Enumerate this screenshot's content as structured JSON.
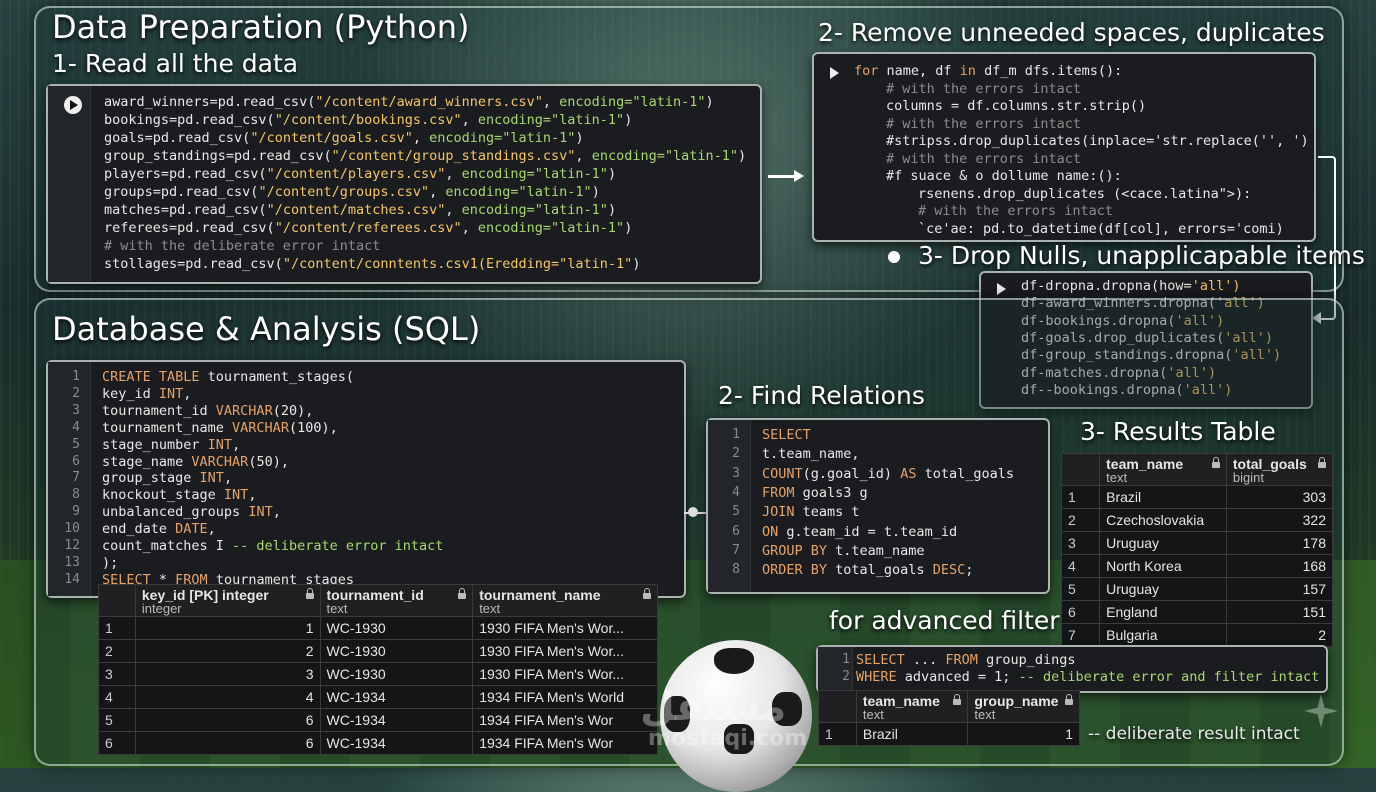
{
  "python": {
    "title": "Data Preparation (Python)",
    "step1": "1- Read all the data",
    "read_lines": [
      {
        "a": "award_winners=pd.read_csv(",
        "s": "\"/content/award_winners.csv\"",
        "b": ", ",
        "e": "encoding=\"latin-1\"",
        "c": ")"
      },
      {
        "a": "bookings=pd.read_csv(",
        "s": "\"/content/bookings.csv\"",
        "b": ", ",
        "e": "encoding=\"latin-1\"",
        "c": ")"
      },
      {
        "a": "goals=pd.read_csv(",
        "s": "\"/content/goals.csv\"",
        "b": ", ",
        "e": "encoding=\"latin-1\"",
        "c": ")"
      },
      {
        "a": "group_standings=pd.read_csv(",
        "s": "\"/content/group_standings.csv\"",
        "b": ", ",
        "e": "encoding=\"latin-1\"",
        "c": ")"
      },
      {
        "a": "players=pd.read_csv(",
        "s": "\"/content/players.csv\"",
        "b": ", ",
        "e": "encoding=\"latin-1\"",
        "c": ")"
      },
      {
        "a": "groups=pd.read_csv(",
        "s": "\"/content/groups.csv\"",
        "b": ", ",
        "e": "encoding=\"latin-1\"",
        "c": ")"
      },
      {
        "a": "matches=pd.read_csv(",
        "s": "\"/content/matches.csv\"",
        "b": ", ",
        "e": "encoding=\"latin-1\"",
        "c": ")"
      },
      {
        "a": "referees=pd.read_csv(",
        "s": "\"/content/referees.csv\"",
        "b": ", ",
        "e": "encoding=\"latin-1\"",
        "c": ")"
      },
      {
        "cmt": "# with the deliberate error intact"
      },
      {
        "a": "stollages=pd.read_csv(",
        "s": "\"/content/conntents.csv1(Eredding=\"latin-1\"",
        "b": "",
        "e": "",
        "c": ")"
      }
    ],
    "step2": "2- Remove unneeded spaces, duplicates",
    "clean_lines": [
      {
        "t": "for name, df in df_m dfs.items():",
        "ind": 0
      },
      {
        "t": "# with the errors intact",
        "ind": 1,
        "cmt": true
      },
      {
        "t": "columns = df.columns.str.strip()",
        "ind": 1
      },
      {
        "t": "# with the errors intact",
        "ind": 1,
        "cmt": true
      },
      {
        "t": "#stripss.drop_duplicates(inplace='str.replace('', ')",
        "ind": 1
      },
      {
        "t": "# with the errors intact",
        "ind": 1,
        "cmt": true
      },
      {
        "t": "#f suace & o dollume name:():",
        "ind": 1
      },
      {
        "t": "rsenens.drop_duplicates (<cace.latina\">):",
        "ind": 2
      },
      {
        "t": "# with the errors intact",
        "ind": 2,
        "cmt": true
      },
      {
        "t": "`ce'ae: pd.to_datetime(df[col], errors='comi)",
        "ind": 2
      }
    ],
    "step3": "3- Drop Nulls, unapplicapable items",
    "drop_lines": [
      "df-dropna.dropna(how='all')",
      "df-award_winners.dropna('all')",
      "df-bookings.dropna('all')",
      "df-goals.drop_duplicates('all')",
      "df-group_standings.dropna('all')",
      "df-matches.dropna('all')",
      "df--bookings.dropna('all')"
    ]
  },
  "sql": {
    "title": "Database & Analysis (SQL)",
    "create_lines": [
      "CREATE TABLE tournament_stages(",
      "key_id INT,",
      "tournament_id VARCHAR(20),",
      "tournament_name VARCHAR(100),",
      "stage_number INT,",
      "stage_name VARCHAR(50),",
      "group_stage INT,",
      "knockout_stage INT,",
      "unbalanced_groups INT,",
      "end_date DATE,",
      "count_matches I -- deliberate error intact",
      ");",
      "SELECT * FROM tournament_stages"
    ],
    "create_line_numbers": [
      "1",
      "2",
      "3",
      "4",
      "5",
      "6",
      "7",
      "8",
      "9",
      "10",
      "12",
      "13",
      "14"
    ],
    "stages_table": {
      "headers": [
        {
          "name": "key_id [PK] integer",
          "type": "integer"
        },
        {
          "name": "tournament_id",
          "type": "text"
        },
        {
          "name": "tournament_name",
          "type": "text"
        }
      ],
      "rows": [
        [
          "1",
          "1",
          "WC-1930",
          "1930 FIFA Men's Wor..."
        ],
        [
          "2",
          "2",
          "WC-1930",
          "1930 FIFA Men's Wor..."
        ],
        [
          "3",
          "3",
          "WC-1930",
          "1930 FIFA Men's Wor..."
        ],
        [
          "4",
          "4",
          "WC-1934",
          "1934 FIFA Men's World"
        ],
        [
          "5",
          "6",
          "WC-1934",
          "1934 FIFA Men's Wor"
        ],
        [
          "6",
          "6",
          "WC-1934",
          "1934 FIFA Men's Wor"
        ]
      ]
    },
    "relations_title": "2- Find Relations",
    "relations_lines": [
      "SELECT",
      "t.team_name,",
      "COUNT(g.goal_id) AS total_goals",
      "FROM goals3 g",
      "JOIN teams t",
      "ON g.team_id = t.team_id",
      "GROUP BY t.team_name",
      "ORDER BY total_goals DESC;"
    ],
    "results_title": "3- Results Table",
    "results_table": {
      "headers": [
        {
          "name": "team_name",
          "type": "text"
        },
        {
          "name": "total_goals",
          "type": "bigint"
        }
      ],
      "rows": [
        [
          "1",
          "Brazil",
          "303"
        ],
        [
          "2",
          "Czechoslovakia",
          "322"
        ],
        [
          "3",
          "Uruguay",
          "178"
        ],
        [
          "4",
          "North Korea",
          "168"
        ],
        [
          "5",
          "Uruguay",
          "157"
        ],
        [
          "6",
          "England",
          "151"
        ],
        [
          "7",
          "Bulgaria",
          "2"
        ]
      ]
    },
    "filter_title": "for advanced filter",
    "filter_lines": [
      "SELECT ... FROM group_dings",
      "WHERE advanced = 1; -- deliberate error and filter intact"
    ],
    "filter_table": {
      "headers": [
        {
          "name": "team_name",
          "type": "text"
        },
        {
          "name": "group_name",
          "type": "text"
        }
      ],
      "rows": [
        [
          "1",
          "Brazil",
          "1"
        ]
      ]
    },
    "filter_note": "-- deliberate result intact"
  },
  "watermark": {
    "arabic": "مستقل",
    "latin": "mostaqi.com"
  },
  "colors": {
    "keyword": "#e5a26a",
    "string": "#f5c56a",
    "encoding": "#a6d872",
    "comment": "#8c8c8c",
    "code_bg": "#1a1c1f"
  }
}
